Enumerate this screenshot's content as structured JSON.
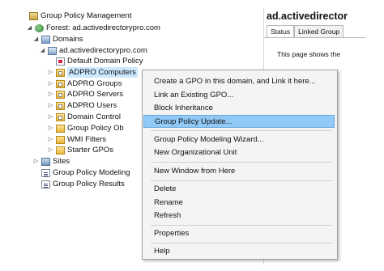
{
  "tree": {
    "root": "Group Policy Management",
    "forest": "Forest: ad.activedirectorypro.com",
    "domains": "Domains",
    "domain": "ad.activedirectorypro.com",
    "children": [
      "Default Domain Policy",
      "ADPRO Computers",
      "ADPRO Groups",
      "ADPRO Servers",
      "ADPRO Users",
      "Domain Control",
      "Group Policy Ob",
      "WMI Filters",
      "Starter GPOs"
    ],
    "sites": "Sites",
    "modeling": "Group Policy Modeling",
    "results": "Group Policy Results"
  },
  "right_pane": {
    "title": "ad.activedirector",
    "tabs": [
      "Status",
      "Linked Group"
    ],
    "text": "This page shows the"
  },
  "context_menu": {
    "items": [
      "Create a GPO in this domain, and Link it here...",
      "Link an Existing GPO...",
      "Block Inheritance",
      "Group Policy Update...",
      "Group Policy Modeling Wizard...",
      "New Organizational Unit",
      "New Window from Here",
      "Delete",
      "Rename",
      "Refresh",
      "Properties",
      "Help"
    ],
    "highlighted": "Group Policy Update..."
  }
}
